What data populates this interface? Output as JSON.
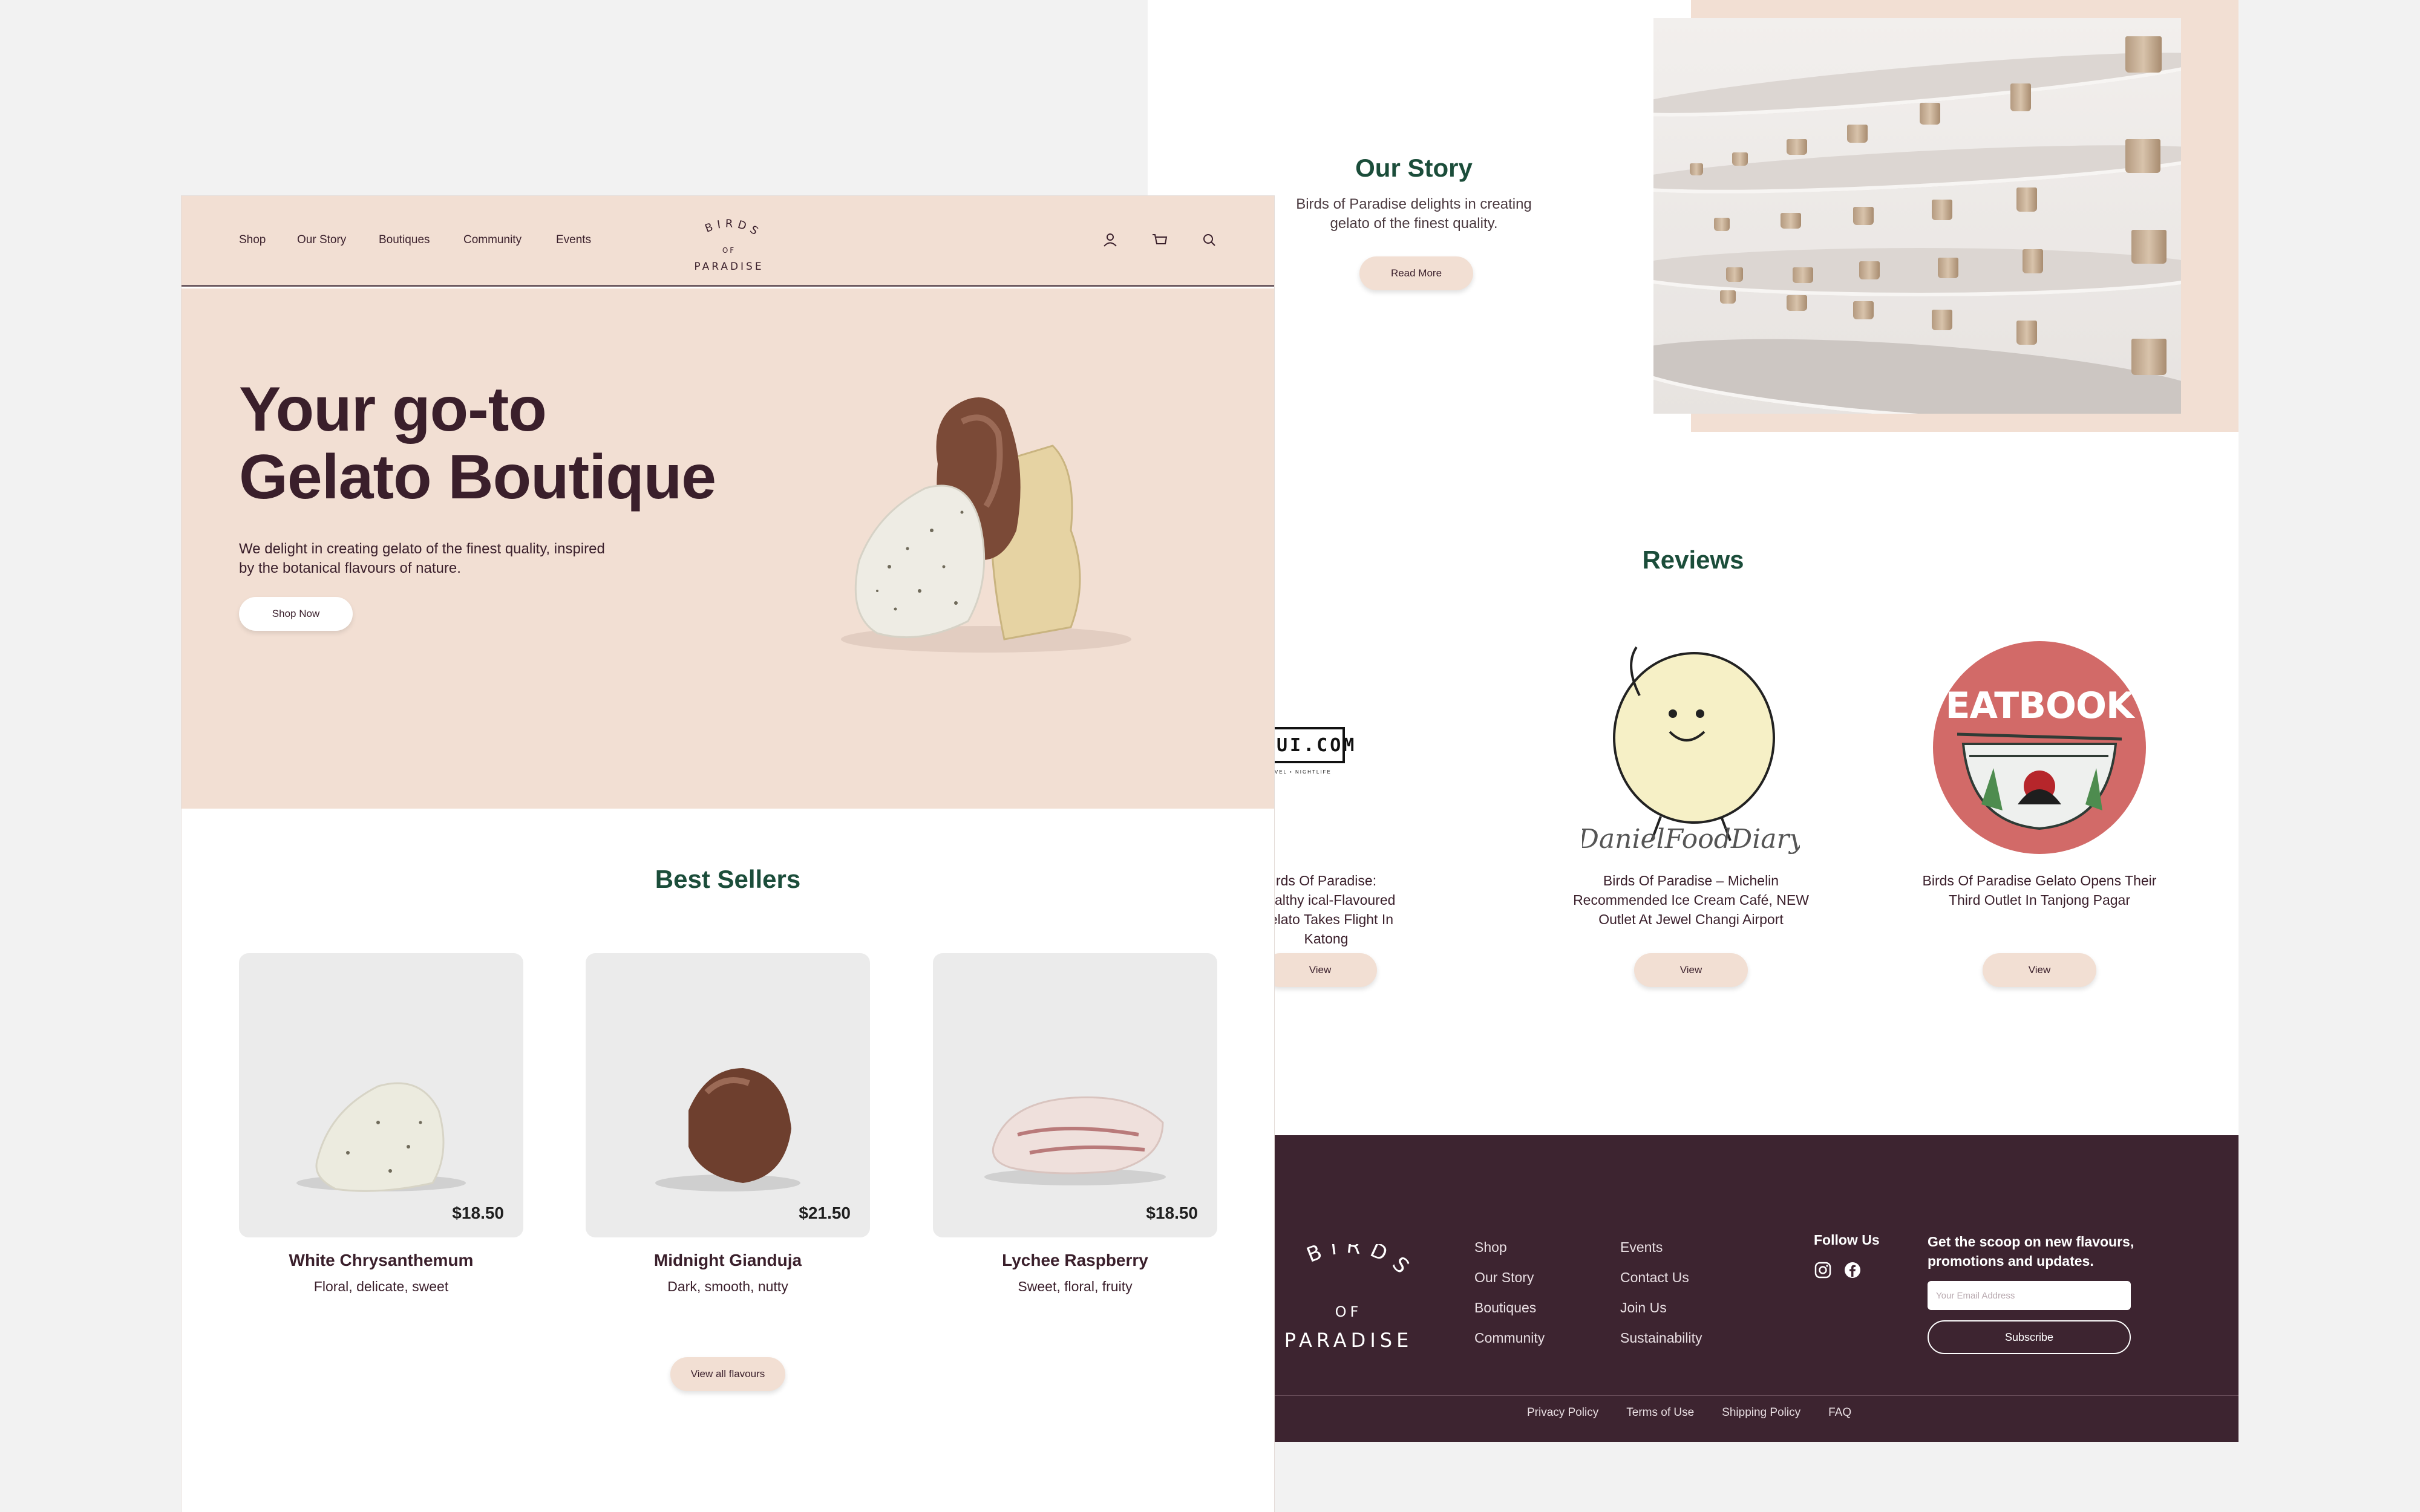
{
  "nav": {
    "links": [
      "Shop",
      "Our Story",
      "Boutiques",
      "Community",
      "Events"
    ],
    "logo_top": "BIRDS",
    "logo_mid": "OF",
    "logo_bottom": "PARADISE"
  },
  "hero": {
    "title_line1": "Your go-to",
    "title_line2": "Gelato Boutique",
    "subtitle": "We delight in creating gelato of the finest quality, inspired by the botanical flavours of nature.",
    "cta": "Shop Now"
  },
  "best_sellers": {
    "title": "Best Sellers",
    "items": [
      {
        "name": "White Chrysanthemum",
        "desc": "Floral, delicate, sweet",
        "price": "$18.50"
      },
      {
        "name": "Midnight Gianduja",
        "desc": "Dark, smooth, nutty",
        "price": "$21.50"
      },
      {
        "name": "Lychee Raspberry",
        "desc": "Sweet, floral, fruity",
        "price": "$18.50"
      }
    ],
    "view_all": "View all flavours"
  },
  "story": {
    "title": "Our Story",
    "text": "Birds of Paradise delights in creating gelato of the finest quality.",
    "button": "Read More"
  },
  "reviews": {
    "title": "Reviews",
    "items": [
      {
        "source": "SETHLUI.COM",
        "tagline": "FOOD • TRAVEL • NIGHTLIFE",
        "text": "rds Of Paradise: Healthy ical-Flavoured Gelato Takes Flight In Katong",
        "button": "View"
      },
      {
        "source": "DanielFoodDiary",
        "text": "Birds Of Paradise – Michelin Recommended Ice Cream Café, NEW Outlet At Jewel Changi Airport",
        "button": "View"
      },
      {
        "source": "EATBOOK",
        "text": "Birds Of Paradise Gelato Opens Their Third Outlet In Tanjong Pagar",
        "button": "View"
      }
    ]
  },
  "footer": {
    "col1": [
      "Shop",
      "Our Story",
      "Boutiques",
      "Community"
    ],
    "col2": [
      "Events",
      "Contact Us",
      "Join Us",
      "Sustainability"
    ],
    "follow_title": "Follow Us",
    "newsletter_text": "Get the scoop on new flavours, promotions and updates.",
    "email_placeholder": "Your Email Address",
    "subscribe": "Subscribe",
    "legal": [
      "Privacy Policy",
      "Terms of Use",
      "Shipping Policy",
      "FAQ"
    ]
  },
  "colors": {
    "blush": "#f2dfd3",
    "plum": "#3d2430",
    "forest": "#1b4d3a",
    "eatbook_red": "#d26a68"
  }
}
